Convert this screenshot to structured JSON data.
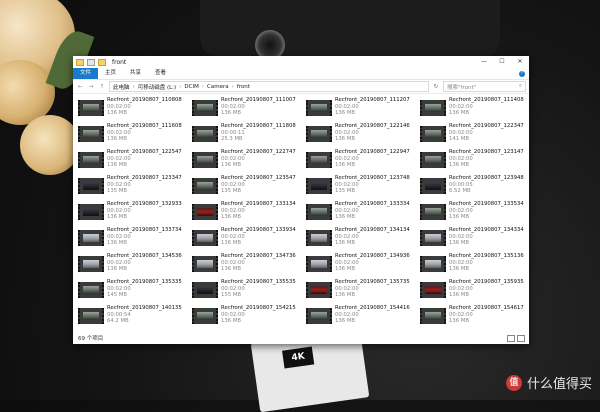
{
  "window": {
    "title": "front",
    "minimize": "—",
    "maximize": "☐",
    "close": "✕"
  },
  "ribbon": {
    "tabs": [
      "文件",
      "主页",
      "共享",
      "查看"
    ],
    "help": "?"
  },
  "address": {
    "back": "←",
    "forward": "→",
    "up": "↑",
    "crumbs": [
      "此电脑",
      "可移动磁盘 (L:)",
      "DCIM",
      "Camera",
      "front"
    ],
    "refresh": "↻"
  },
  "search": {
    "placeholder": "搜索\"front\"",
    "icon": "search-icon"
  },
  "files": [
    {
      "name": "Recfront_20190807_110808",
      "duration": "00:02:00",
      "size": "136 MB",
      "thumb": "normal"
    },
    {
      "name": "Recfront_20190807_111007",
      "duration": "00:02:00",
      "size": "136 MB",
      "thumb": "normal"
    },
    {
      "name": "Recfront_20190807_111207",
      "duration": "00:02:00",
      "size": "136 MB",
      "thumb": "normal"
    },
    {
      "name": "Recfront_20190807_111408",
      "duration": "00:02:00",
      "size": "136 MB",
      "thumb": "normal"
    },
    {
      "name": "Recfront_20190807_111608",
      "duration": "00:02:00",
      "size": "136 MB",
      "thumb": "normal"
    },
    {
      "name": "Recfront_20190807_111808",
      "duration": "00:00:11",
      "size": "25.3 MB",
      "thumb": "normal"
    },
    {
      "name": "Recfront_20190807_122146",
      "duration": "00:02:00",
      "size": "136 MB",
      "thumb": "normal"
    },
    {
      "name": "Recfront_20190807_122347",
      "duration": "00:02:00",
      "size": "141 MB",
      "thumb": "normal"
    },
    {
      "name": "Recfront_20190807_122547",
      "duration": "00:02:00",
      "size": "136 MB",
      "thumb": "normal"
    },
    {
      "name": "Recfront_20190807_122747",
      "duration": "00:02:00",
      "size": "136 MB",
      "thumb": "normal"
    },
    {
      "name": "Recfront_20190807_122947",
      "duration": "00:02:00",
      "size": "136 MB",
      "thumb": "normal"
    },
    {
      "name": "Recfront_20190807_123147",
      "duration": "00:02:00",
      "size": "136 MB",
      "thumb": "normal"
    },
    {
      "name": "Recfront_20190807_123347",
      "duration": "00:02:00",
      "size": "135 MB",
      "thumb": "dark"
    },
    {
      "name": "Recfront_20190807_123547",
      "duration": "00:02:00",
      "size": "135 MB",
      "thumb": "normal"
    },
    {
      "name": "Recfront_20190807_123748",
      "duration": "00:02:00",
      "size": "135 MB",
      "thumb": "dark"
    },
    {
      "name": "Recfront_20190807_123948",
      "duration": "00:00:05",
      "size": "6.52 MB",
      "thumb": "dark"
    },
    {
      "name": "Recfront_20190807_132933",
      "duration": "00:02:00",
      "size": "136 MB",
      "thumb": "dark"
    },
    {
      "name": "Recfront_20190807_133134",
      "duration": "00:02:00",
      "size": "136 MB",
      "thumb": "red"
    },
    {
      "name": "Recfront_20190807_133334",
      "duration": "00:02:00",
      "size": "136 MB",
      "thumb": "normal"
    },
    {
      "name": "Recfront_20190807_133534",
      "duration": "00:02:00",
      "size": "136 MB",
      "thumb": "normal"
    },
    {
      "name": "Recfront_20190807_133734",
      "duration": "00:02:00",
      "size": "136 MB",
      "thumb": "bright"
    },
    {
      "name": "Recfront_20190807_133934",
      "duration": "00:02:00",
      "size": "136 MB",
      "thumb": "bright"
    },
    {
      "name": "Recfront_20190807_134134",
      "duration": "00:02:00",
      "size": "136 MB",
      "thumb": "bright"
    },
    {
      "name": "Recfront_20190807_134334",
      "duration": "00:02:00",
      "size": "136 MB",
      "thumb": "bright"
    },
    {
      "name": "Recfront_20190807_134536",
      "duration": "00:02:00",
      "size": "136 MB",
      "thumb": "bright"
    },
    {
      "name": "Recfront_20190807_134736",
      "duration": "00:02:00",
      "size": "136 MB",
      "thumb": "bright"
    },
    {
      "name": "Recfront_20190807_134936",
      "duration": "00:02:00",
      "size": "136 MB",
      "thumb": "bright"
    },
    {
      "name": "Recfront_20190807_135136",
      "duration": "00:02:00",
      "size": "136 MB",
      "thumb": "bright"
    },
    {
      "name": "Recfront_20190807_135335",
      "duration": "00:02:00",
      "size": "145 MB",
      "thumb": "normal"
    },
    {
      "name": "Recfront_20190807_135535",
      "duration": "00:02:00",
      "size": "155 MB",
      "thumb": "dark"
    },
    {
      "name": "Recfront_20190807_135735",
      "duration": "00:02:00",
      "size": "136 MB",
      "thumb": "red"
    },
    {
      "name": "Recfront_20190807_135935",
      "duration": "00:02:00",
      "size": "136 MB",
      "thumb": "red"
    },
    {
      "name": "Recfront_20190807_140135",
      "duration": "00:00:54",
      "size": "64.2 MB",
      "thumb": "normal"
    },
    {
      "name": "Recfront_20190807_154215",
      "duration": "00:02:00",
      "size": "136 MB",
      "thumb": "normal"
    },
    {
      "name": "Recfront_20190807_154416",
      "duration": "00:02:00",
      "size": "136 MB",
      "thumb": "normal"
    },
    {
      "name": "Recfront_20190807_154617",
      "duration": "00:02:00",
      "size": "136 MB",
      "thumb": "normal"
    }
  ],
  "status": {
    "count": "69 个项目"
  },
  "background": {
    "card_logo": "4K",
    "watermark": "什么值得买",
    "watermark_badge": "值"
  }
}
